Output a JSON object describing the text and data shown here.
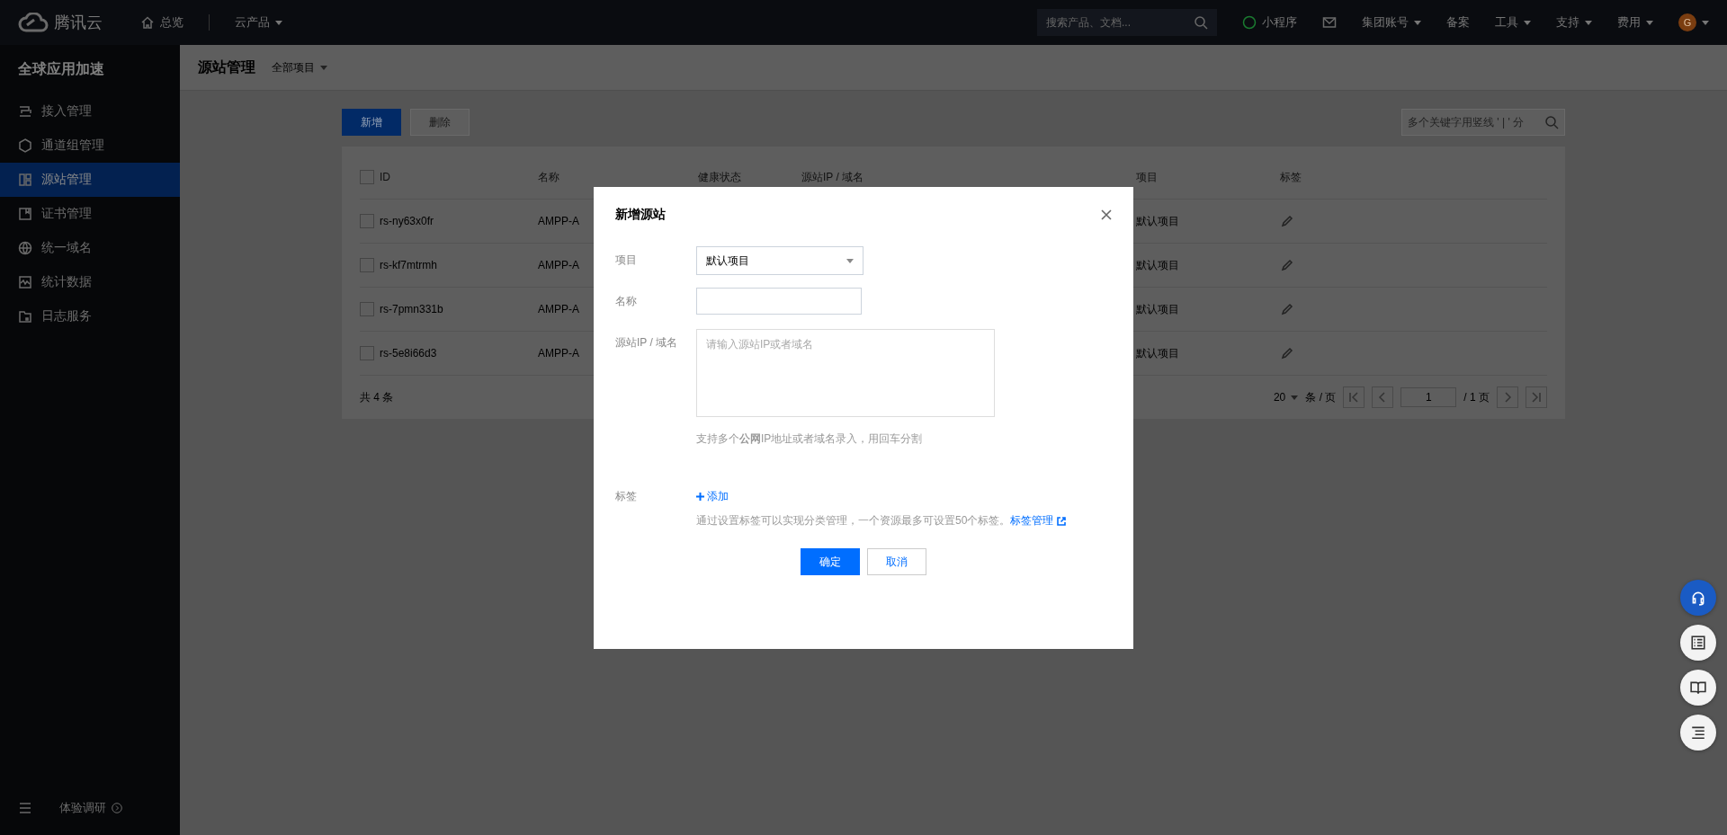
{
  "topbar": {
    "logo": "腾讯云",
    "nav": [
      {
        "label": "总览",
        "dropdown": false
      },
      {
        "label": "云产品",
        "dropdown": true
      }
    ],
    "search": {
      "placeholder": "搜索产品、文档..."
    },
    "right": [
      {
        "kind": "icon-text",
        "label": "小程序"
      },
      {
        "kind": "mail"
      },
      {
        "kind": "text",
        "label": "集团账号",
        "dropdown": true
      },
      {
        "kind": "text",
        "label": "备案",
        "dropdown": false
      },
      {
        "kind": "text",
        "label": "工具",
        "dropdown": true
      },
      {
        "kind": "text",
        "label": "支持",
        "dropdown": true
      },
      {
        "kind": "text",
        "label": "费用",
        "dropdown": true
      },
      {
        "kind": "avatar",
        "label": "G"
      }
    ]
  },
  "sidebar": {
    "title": "全球应用加速",
    "items": [
      {
        "label": "接入管理",
        "selected": false
      },
      {
        "label": "通道组管理",
        "selected": false
      },
      {
        "label": "源站管理",
        "selected": true
      },
      {
        "label": "证书管理",
        "selected": false
      },
      {
        "label": "统一域名",
        "selected": false
      },
      {
        "label": "统计数据",
        "selected": false
      },
      {
        "label": "日志服务",
        "selected": false
      }
    ],
    "footer": "体验调研"
  },
  "header": {
    "title": "源站管理",
    "project": "全部项目"
  },
  "toolbar": {
    "buttons": [
      {
        "label": "新增",
        "primary": true
      },
      {
        "label": "删除",
        "primary": false
      }
    ],
    "search": {
      "placeholder": "多个关键字用竖线 ' | ' 分"
    }
  },
  "table": {
    "all_checked": false,
    "columns": [
      "ID",
      "名称",
      "健康状态",
      "源站IP / 域名",
      "项目",
      "标签"
    ],
    "rows": [
      {
        "id": "rs-ny63x0fr",
        "name": "AMPP-A",
        "project": "默认项目",
        "checked": false
      },
      {
        "id": "rs-kf7mtrmh",
        "name": "AMPP-A",
        "project": "默认项目",
        "checked": false
      },
      {
        "id": "rs-7pmn331b",
        "name": "AMPP-A",
        "project": "默认项目",
        "checked": false
      },
      {
        "id": "rs-5e8i66d3",
        "name": "AMPP-A",
        "project": "默认项目",
        "checked": false
      }
    ],
    "total": "共 4 条",
    "page_size": "20",
    "page_size_unit": "条 / 页",
    "page": "1",
    "pages": "/ 1 页"
  },
  "dialog": {
    "title": "新增源站",
    "fields": [
      {
        "kind": "select",
        "label": "项目",
        "value": "默认项目"
      },
      {
        "kind": "input",
        "label": "名称"
      },
      {
        "kind": "textarea",
        "label": "源站IP / 域名",
        "placeholder": "请输入源站IP或者域名",
        "hint": "支持多个**公网**IP地址或者域名录入，用回车分割"
      },
      {
        "kind": "tags",
        "label": "标签",
        "add": "添加",
        "hint": "通过设置标签可以实现分类管理，一个资源最多可设置50个标签。",
        "link": "标签管理"
      }
    ],
    "buttons": [
      {
        "label": "确定",
        "primary": true
      },
      {
        "label": "取消",
        "primary": false
      }
    ]
  },
  "float_buttons": [
    {
      "highlighted": true
    },
    {
      "highlighted": false
    },
    {
      "highlighted": false
    },
    {
      "highlighted": false
    }
  ]
}
